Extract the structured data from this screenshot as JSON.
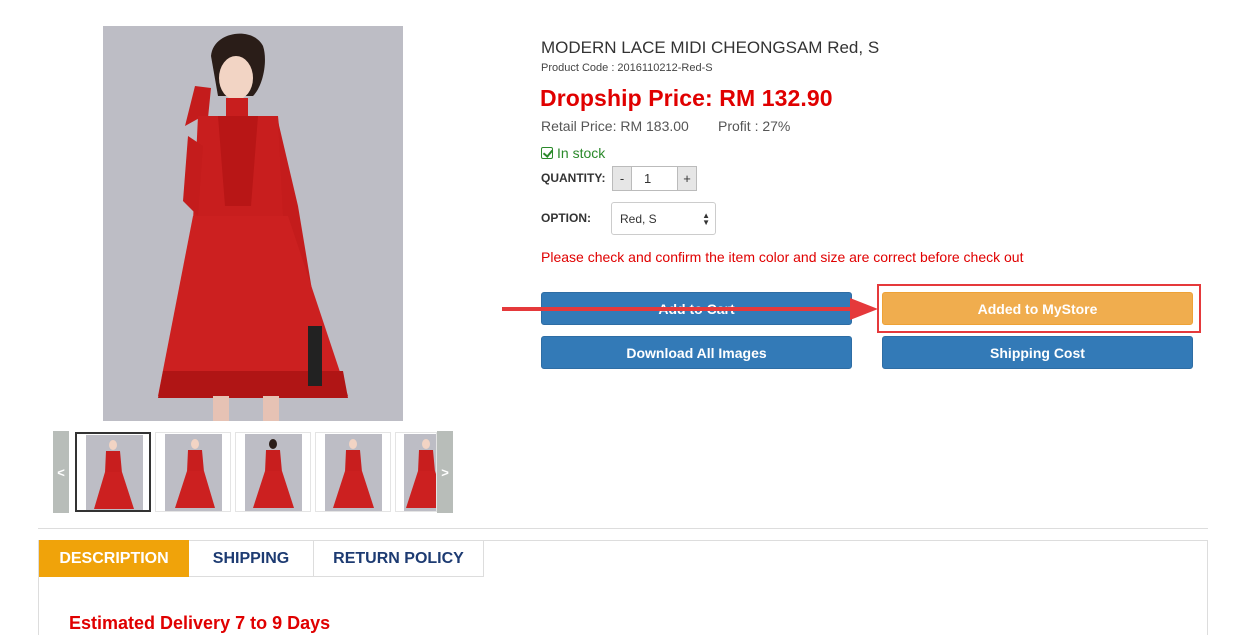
{
  "gallery": {
    "main_image": "red-lace-cheongsam-photo",
    "prev_label": "<",
    "next_label": ">",
    "thumbnails": [
      "front",
      "side",
      "back",
      "front-alt",
      "side-alt"
    ]
  },
  "product": {
    "title": "MODERN LACE MIDI CHEONGSAM Red, S",
    "code_label": "Product Code :",
    "code_value": "2016110212-Red-S",
    "dropship_price": "Dropship Price: RM 132.90",
    "retail_price": "Retail Price: RM 183.00",
    "profit": "Profit : 27%",
    "stock_status": "In stock",
    "quantity_label": "QUANTITY:",
    "quantity_value": "1",
    "minus_label": "-",
    "plus_label": "+",
    "option_label": "OPTION:",
    "option_selected": "Red, S",
    "warning": "Please check and confirm the item color and size are correct before check out"
  },
  "actions": {
    "add_to_cart": "Add to Cart",
    "added_to_mystore": "Added to MyStore",
    "download_images": "Download All Images",
    "shipping_cost": "Shipping Cost"
  },
  "tabs": {
    "description": "DESCRIPTION",
    "shipping": "SHIPPING",
    "return_policy": "RETURN POLICY",
    "active": "DESCRIPTION"
  },
  "description": {
    "estimated_delivery": "Estimated Delivery 7 to 9 Days"
  },
  "colors": {
    "price_red": "#e00000",
    "button_blue": "#337ab7",
    "button_orange": "#f0ad4e",
    "tab_active": "#f0a30a",
    "stock_green": "#2b8a2b",
    "annotation_red": "#e5393b"
  },
  "annotation": {
    "arrow_icon": "arrow-right-icon"
  }
}
